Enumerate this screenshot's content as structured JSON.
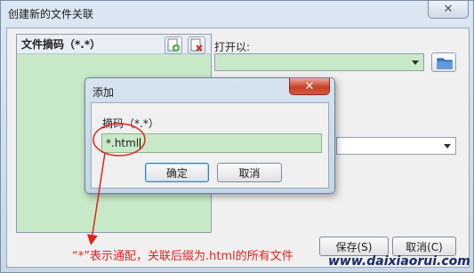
{
  "main_window": {
    "title": "创建新的文件关联",
    "close_icon": "close-icon",
    "extension_list_header": "文件摘码（*.*）",
    "add_button_icon": "add-file-icon",
    "delete_button_icon": "delete-file-icon",
    "open_with_label": "打开以:",
    "open_with_value": "",
    "folder_button_icon": "folder-icon",
    "second_combo_value": "",
    "save_label": "保存(S)",
    "cancel_label": "取消(C)"
  },
  "add_dialog": {
    "title": "添加",
    "close_icon": "close-icon",
    "field_label": "摘码（*.*）",
    "field_value": "*.html",
    "ok_label": "确定",
    "cancel_label": "取消"
  },
  "annotation": {
    "text": "“*”表示通配，关联后缀为.html的所有文件",
    "color": "#e0231e"
  },
  "watermark": {
    "text": "www.daixiaorui.com"
  },
  "colors": {
    "list_background": "#c8e9c8",
    "dialog_close": "#c7402a",
    "annotation_red": "#e0231e"
  }
}
